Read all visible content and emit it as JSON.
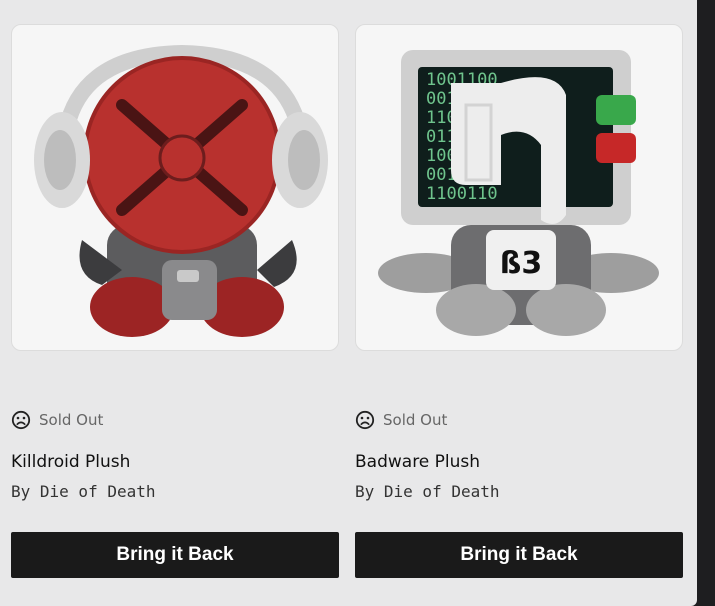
{
  "products": [
    {
      "status_icon": "sad-face-icon",
      "status": "Sold Out",
      "name": "Killdroid Plush",
      "creator": "By Die of Death",
      "button_label": "Bring it Back",
      "image": "killdroid-plush-image"
    },
    {
      "status_icon": "sad-face-icon",
      "status": "Sold Out",
      "name": "Badware Plush",
      "creator": "By Die of Death",
      "button_label": "Bring it Back",
      "image": "badware-plush-image",
      "screen_text": [
        "1001100",
        "0011001",
        "1100110",
        "0110011",
        "1001100",
        "0011001",
        "1100110"
      ]
    }
  ],
  "colors": {
    "panel": "#e8e8e9",
    "button": "#1a1a1a",
    "sold_out_text": "#666666"
  }
}
